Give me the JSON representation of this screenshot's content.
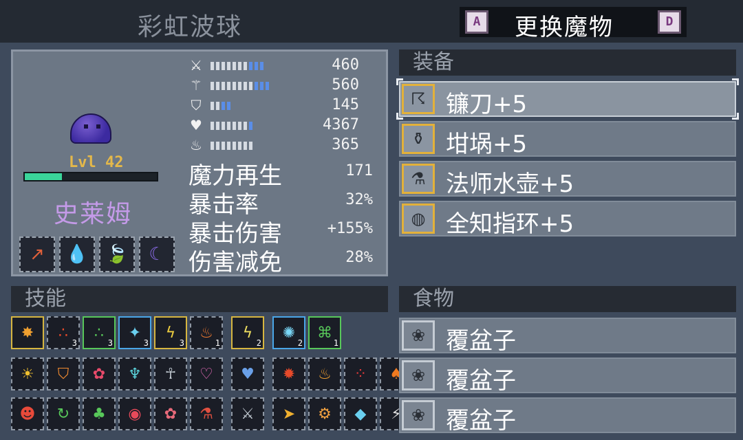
{
  "header": {
    "title": "彩虹波球",
    "swap_label": "更换魔物",
    "key_left": "A",
    "key_right": "D"
  },
  "monster": {
    "name": "史莱姆",
    "level": "Lvl 42",
    "xp_fraction": 0.28
  },
  "stats": [
    {
      "icon": "sword-icon",
      "glyph": "⚔",
      "value": "460",
      "white": 7,
      "blue": 3
    },
    {
      "icon": "staff-icon",
      "glyph": "⚚",
      "value": "560",
      "white": 8,
      "blue": 3
    },
    {
      "icon": "shield-icon",
      "glyph": "⛉",
      "value": "145",
      "white": 2,
      "blue": 2
    },
    {
      "icon": "heart-icon",
      "glyph": "♥",
      "value": "4367",
      "white": 7,
      "blue": 1
    },
    {
      "icon": "mana-potion-icon",
      "glyph": "♨",
      "value": "365",
      "white": 8,
      "blue": 0
    }
  ],
  "extra_stats": [
    {
      "label": "魔力再生",
      "value": "171"
    },
    {
      "label": "暴击率",
      "value": "32%"
    },
    {
      "label": "暴击伤害",
      "value": "+155%"
    },
    {
      "label": "伤害减免",
      "value": "28%"
    }
  ],
  "perks": [
    {
      "icon": "attack-up-icon",
      "glyph": "↗",
      "color": "#e0603a"
    },
    {
      "icon": "water-shield-icon",
      "glyph": "💧",
      "color": "#4a90e0"
    },
    {
      "icon": "leaf-shield-icon",
      "glyph": "🍃",
      "color": "#58c85a"
    },
    {
      "icon": "moon-icon",
      "glyph": "☾",
      "color": "#8a6ae8"
    }
  ],
  "equipment": {
    "heading": "装备",
    "items": [
      {
        "icon": "scythe-icon",
        "glyph": "☈",
        "label": "镰刀+5",
        "selected": true
      },
      {
        "icon": "cauldron-icon",
        "glyph": "⚱",
        "label": "坩埚+5",
        "selected": false
      },
      {
        "icon": "flask-icon",
        "glyph": "⚗",
        "label": "法师水壶+5",
        "selected": false
      },
      {
        "icon": "ring-icon",
        "glyph": "◍",
        "label": "全知指环+5",
        "selected": false
      }
    ]
  },
  "food": {
    "heading": "食物",
    "items": [
      {
        "icon": "raspberry-icon",
        "glyph": "❀",
        "label": "覆盆子"
      },
      {
        "icon": "raspberry-icon",
        "glyph": "❀",
        "label": "覆盆子"
      },
      {
        "icon": "raspberry-icon",
        "glyph": "❀",
        "label": "覆盆子"
      }
    ]
  },
  "skills": {
    "heading": "技能",
    "row1": [
      {
        "icon": "fire-burst-skill-icon",
        "glyph": "✸",
        "color": "#f0a030",
        "count": "",
        "style": "active"
      },
      {
        "icon": "fireballs-skill-icon",
        "glyph": "∴",
        "color": "#e84a2a",
        "count": "3",
        "style": ""
      },
      {
        "icon": "green-orbs-skill-icon",
        "glyph": "∴",
        "color": "#58c85a",
        "count": "3",
        "style": "green"
      },
      {
        "icon": "ice-star-skill-icon",
        "glyph": "✦",
        "color": "#6ad0f0",
        "count": "3",
        "style": "blue"
      },
      {
        "icon": "lightning-skill-icon",
        "glyph": "ϟ",
        "color": "#f0d040",
        "count": "3",
        "style": "active"
      },
      {
        "icon": "flame-skill-icon",
        "glyph": "♨",
        "color": "#f07a30",
        "count": "1",
        "style": ""
      },
      {
        "gap": true
      },
      {
        "icon": "thunder-skill-icon",
        "glyph": "ϟ",
        "color": "#f0e060",
        "count": "2",
        "style": "active"
      },
      {
        "gap": true
      },
      {
        "icon": "frost-burst-skill-icon",
        "glyph": "✺",
        "color": "#7ad8f8",
        "count": "2",
        "style": "blue"
      },
      {
        "icon": "green-chain-skill-icon",
        "glyph": "⌘",
        "color": "#58c85a",
        "count": "1",
        "style": "green"
      }
    ],
    "row2": [
      {
        "icon": "sun-skill-icon",
        "glyph": "☀",
        "color": "#f0c030"
      },
      {
        "icon": "fire-shield-skill-icon",
        "glyph": "⛉",
        "color": "#f08a30"
      },
      {
        "icon": "red-paw-skill-icon",
        "glyph": "✿",
        "color": "#e84a6a"
      },
      {
        "icon": "horned-skull-skill-icon",
        "glyph": "♆",
        "color": "#5ad0d8"
      },
      {
        "icon": "ghost-skill-icon",
        "glyph": "☥",
        "color": "#c0c8d0"
      },
      {
        "icon": "pink-wings-skill-icon",
        "glyph": "♡",
        "color": "#f070c0"
      },
      {
        "gap": true
      },
      {
        "icon": "blue-heart-skill-icon",
        "glyph": "♥",
        "color": "#6aa0e8"
      },
      {
        "gap": true
      },
      {
        "icon": "red-gear-skill-icon",
        "glyph": "✹",
        "color": "#e84a2a"
      },
      {
        "icon": "fire-skill-icon",
        "glyph": "♨",
        "color": "#f0a030"
      },
      {
        "icon": "red-dots-skill-icon",
        "glyph": "⁘",
        "color": "#e83a3a"
      },
      {
        "icon": "fire-bird-skill-icon",
        "glyph": "♠",
        "color": "#f07a20"
      }
    ],
    "row3": [
      {
        "icon": "red-mask-skill-icon",
        "glyph": "☻",
        "color": "#e84a3a"
      },
      {
        "icon": "cycle-skill-icon",
        "glyph": "↻",
        "color": "#58c85a"
      },
      {
        "icon": "green-heart-skill-icon",
        "glyph": "♣",
        "color": "#58c85a"
      },
      {
        "icon": "red-eye-skill-icon",
        "glyph": "◉",
        "color": "#e84a5a"
      },
      {
        "icon": "red-claw-skill-icon",
        "glyph": "✿",
        "color": "#e86a7a"
      },
      {
        "icon": "potion-skill-icon",
        "glyph": "⚗",
        "color": "#e05040"
      },
      {
        "gap": true
      },
      {
        "icon": "sword-slash-skill-icon",
        "glyph": "⚔",
        "color": "#c0c8d0"
      },
      {
        "gap": true
      },
      {
        "icon": "dash-skill-icon",
        "glyph": "➤",
        "color": "#f0b030"
      },
      {
        "icon": "gear-slash-skill-icon",
        "glyph": "⚙",
        "color": "#f0a040"
      },
      {
        "icon": "crystal-skill-icon",
        "glyph": "◆",
        "color": "#6ad0f0"
      },
      {
        "icon": "blade-skill-icon",
        "glyph": "⚡",
        "color": "#e0e0e0"
      }
    ]
  }
}
